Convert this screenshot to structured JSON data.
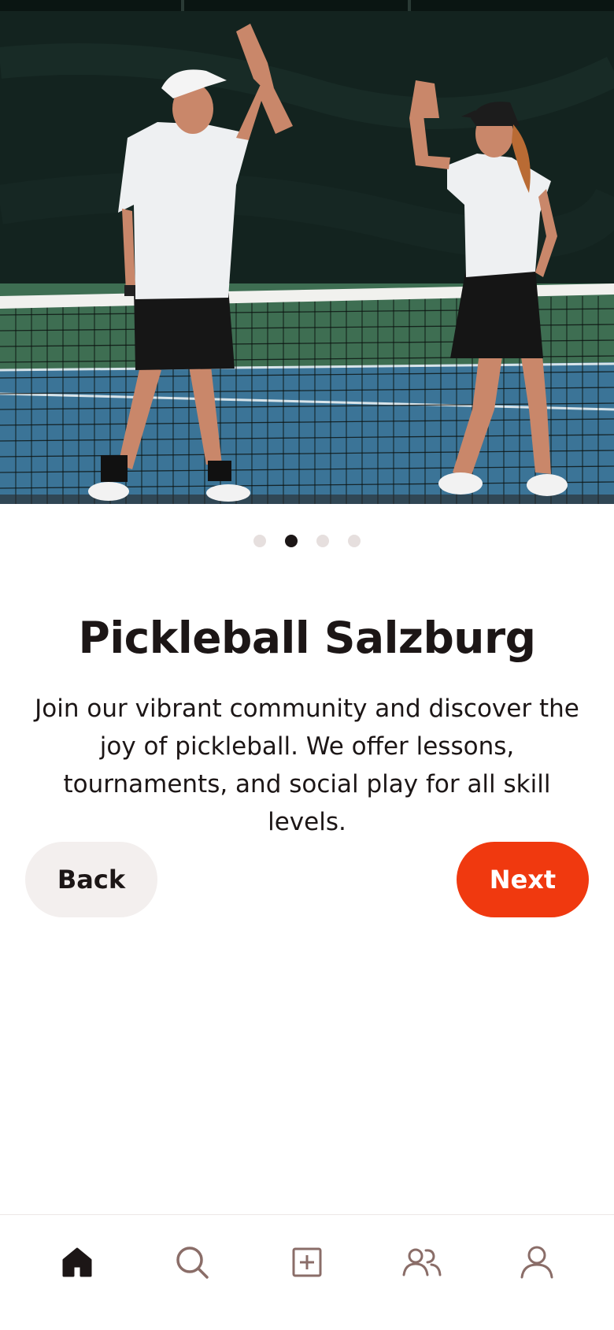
{
  "hero": {
    "image_description_icon": "pickleball-players-high-five-photo"
  },
  "pagination": {
    "total": 4,
    "active_index": 1
  },
  "content": {
    "title": "Pickleball Salzburg",
    "description": "Join our vibrant community and discover the joy of pickleball. We offer lessons, tournaments, and social play for all skill levels."
  },
  "actions": {
    "back_label": "Back",
    "next_label": "Next"
  },
  "tabbar": {
    "items": [
      {
        "icon": "home-icon",
        "active": true
      },
      {
        "icon": "search-icon",
        "active": false
      },
      {
        "icon": "add-square-icon",
        "active": false
      },
      {
        "icon": "community-icon",
        "active": false
      },
      {
        "icon": "profile-icon",
        "active": false
      }
    ]
  },
  "colors": {
    "accent": "#f0390f",
    "text": "#1c1616",
    "secondary_button": "#f3efee",
    "inactive_icon": "#8a6d68",
    "dot_inactive": "#e6dfde"
  }
}
